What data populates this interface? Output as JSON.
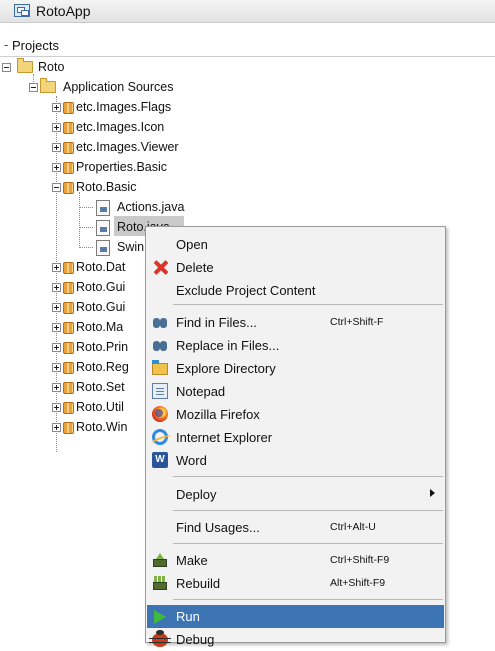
{
  "window": {
    "title": "RotoApp"
  },
  "panel": {
    "title": "Projects"
  },
  "tree": {
    "root": "Roto",
    "sources": "Application Sources",
    "packages_top": [
      "etc.Images.Flags",
      "etc.Images.Icon",
      "etc.Images.Viewer",
      "Properties.Basic",
      "Roto.Basic"
    ],
    "files": [
      "Actions.java",
      "Roto.java",
      "Swin"
    ],
    "packages_bottom": [
      "Roto.Dat",
      "Roto.Gui",
      "Roto.Gui",
      "Roto.Ma",
      "Roto.Prin",
      "Roto.Reg",
      "Roto.Set",
      "Roto.Util",
      "Roto.Win"
    ]
  },
  "menu": {
    "open": "Open",
    "delete": "Delete",
    "exclude": "Exclude Project Content",
    "find_in_files": "Find in Files...",
    "find_in_files_sc": "Ctrl+Shift-F",
    "replace_in_files": "Replace in Files...",
    "explore": "Explore Directory",
    "notepad": "Notepad",
    "firefox": "Mozilla Firefox",
    "ie": "Internet Explorer",
    "word": "Word",
    "deploy": "Deploy",
    "find_usages": "Find Usages...",
    "find_usages_sc": "Ctrl+Alt-U",
    "make": "Make",
    "make_sc": "Ctrl+Shift-F9",
    "rebuild": "Rebuild",
    "rebuild_sc": "Alt+Shift-F9",
    "run": "Run",
    "debug": "Debug"
  }
}
